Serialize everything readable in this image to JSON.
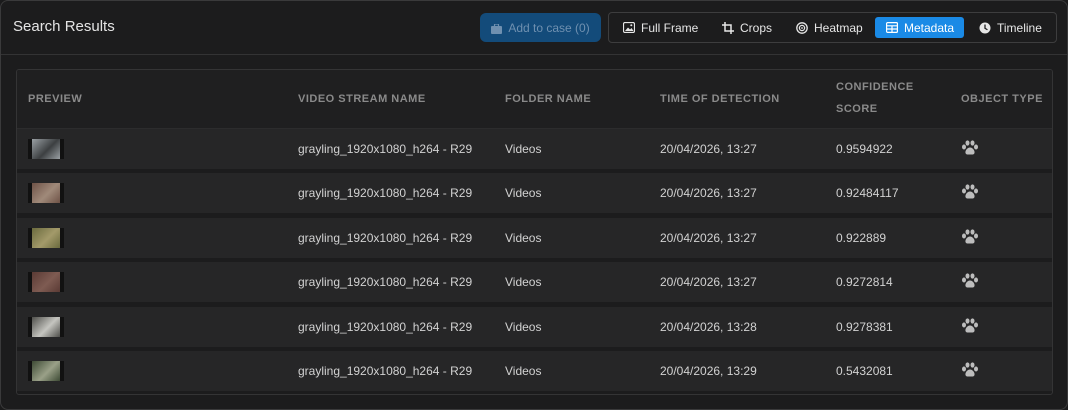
{
  "header": {
    "title": "Search Results",
    "add_to_case": "Add to case (0)"
  },
  "views": {
    "full_frame": "Full Frame",
    "crops": "Crops",
    "heatmap": "Heatmap",
    "metadata": "Metadata",
    "timeline": "Timeline",
    "active": "metadata"
  },
  "table": {
    "columns": {
      "preview": "PREVIEW",
      "video_stream_name": "VIDEO STREAM NAME",
      "folder_name": "FOLDER NAME",
      "time_of_detection": "TIME OF DETECTION",
      "confidence_line1": "CONFIDENCE",
      "confidence_line2": "SCORE",
      "object_type": "OBJECT TYPE"
    },
    "rows": [
      {
        "stream": "grayling_1920x1080_h264 - R29",
        "folder": "Videos",
        "time": "20/04/2026, 13:27",
        "score": "0.9594922",
        "object_icon": "paw-icon",
        "thumb_colors": [
          "#9aa0a4",
          "#3c3f41"
        ]
      },
      {
        "stream": "grayling_1920x1080_h264 - R29",
        "folder": "Videos",
        "time": "20/04/2026, 13:27",
        "score": "0.92484117",
        "object_icon": "paw-icon",
        "thumb_colors": [
          "#6e5246",
          "#a08a7a"
        ]
      },
      {
        "stream": "grayling_1920x1080_h264 - R29",
        "folder": "Videos",
        "time": "20/04/2026, 13:27",
        "score": "0.922889",
        "object_icon": "paw-icon",
        "thumb_colors": [
          "#6a6a3e",
          "#a39a6a"
        ]
      },
      {
        "stream": "grayling_1920x1080_h264 - R29",
        "folder": "Videos",
        "time": "20/04/2026, 13:27",
        "score": "0.9272814",
        "object_icon": "paw-icon",
        "thumb_colors": [
          "#5a3a34",
          "#7e5b52"
        ]
      },
      {
        "stream": "grayling_1920x1080_h264 - R29",
        "folder": "Videos",
        "time": "20/04/2026, 13:28",
        "score": "0.9278381",
        "object_icon": "paw-icon",
        "thumb_colors": [
          "#4e4e4a",
          "#c5c5c0"
        ]
      },
      {
        "stream": "grayling_1920x1080_h264 - R29",
        "folder": "Videos",
        "time": "20/04/2026, 13:29",
        "score": "0.5432081",
        "object_icon": "paw-icon",
        "thumb_colors": [
          "#3d4a34",
          "#9aa088"
        ]
      }
    ]
  },
  "colors": {
    "accent": "#1a8ae6",
    "add_button_bg": "#134b7a"
  }
}
